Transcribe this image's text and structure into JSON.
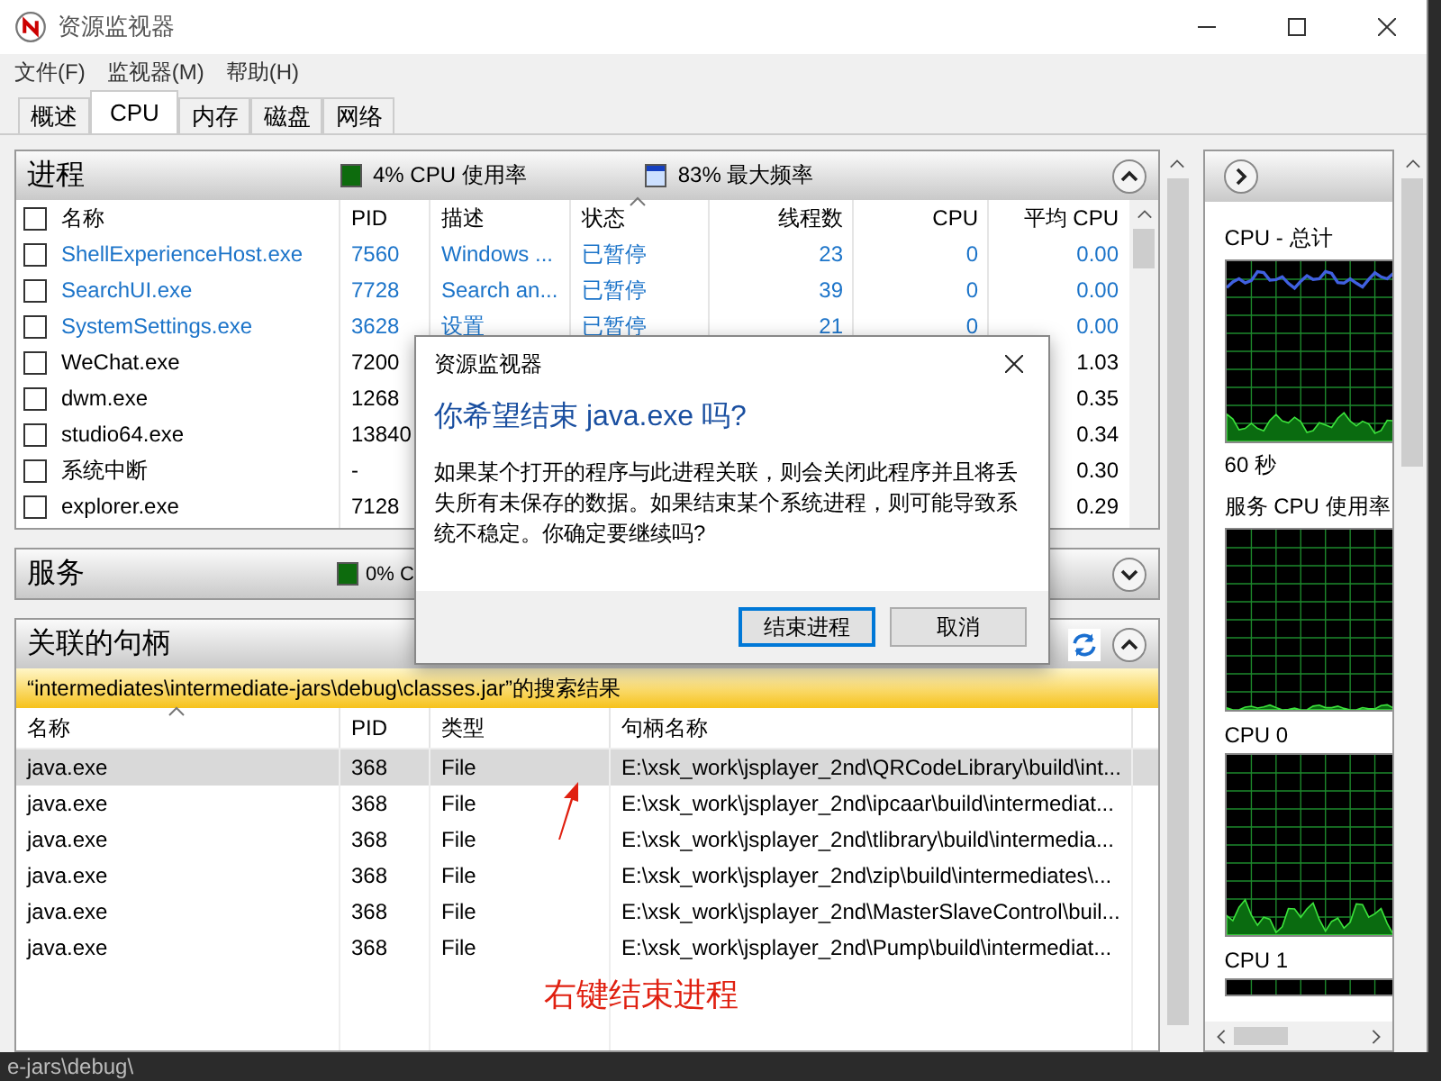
{
  "window": {
    "title": "资源监视器"
  },
  "menu": [
    "文件(F)",
    "监视器(M)",
    "帮助(H)"
  ],
  "tabs": [
    {
      "label": "概述",
      "selected": false
    },
    {
      "label": "CPU",
      "selected": true
    },
    {
      "label": "内存",
      "selected": false
    },
    {
      "label": "磁盘",
      "selected": false
    },
    {
      "label": "网络",
      "selected": false
    }
  ],
  "processes": {
    "title": "进程",
    "usage": "4% CPU 使用率",
    "frequency": "83% 最大频率",
    "expanded": true,
    "all_checked": false,
    "columns": [
      "名称",
      "PID",
      "描述",
      "状态",
      "线程数",
      "CPU",
      "平均 CPU"
    ],
    "rows": [
      {
        "name": "ShellExperienceHost.exe",
        "pid": "7560",
        "description": "Windows ...",
        "status": "已暂停",
        "threads": "23",
        "cpu": "0",
        "avg_cpu": "0.00",
        "suspended": true,
        "checked": false
      },
      {
        "name": "SearchUI.exe",
        "pid": "7728",
        "description": "Search an...",
        "status": "已暂停",
        "threads": "39",
        "cpu": "0",
        "avg_cpu": "0.00",
        "suspended": true,
        "checked": false
      },
      {
        "name": "SystemSettings.exe",
        "pid": "3628",
        "description": "设置",
        "status": "已暂停",
        "threads": "21",
        "cpu": "0",
        "avg_cpu": "0.00",
        "suspended": true,
        "checked": false
      },
      {
        "name": "WeChat.exe",
        "pid": "7200",
        "avg_cpu": "1.03",
        "suspended": false,
        "checked": false
      },
      {
        "name": "dwm.exe",
        "pid": "1268",
        "avg_cpu": "0.35",
        "suspended": false,
        "checked": false
      },
      {
        "name": "studio64.exe",
        "pid": "13840",
        "avg_cpu": "0.34",
        "suspended": false,
        "checked": false
      },
      {
        "name": "系统中断",
        "pid": "-",
        "avg_cpu": "0.30",
        "suspended": false,
        "checked": false
      },
      {
        "name": "explorer.exe",
        "pid": "7128",
        "avg_cpu": "0.29",
        "suspended": false,
        "checked": false
      }
    ]
  },
  "services": {
    "title": "服务",
    "usage": "0% C",
    "expanded": false
  },
  "handles": {
    "title": "关联的句柄",
    "expanded": true,
    "search_result": "“intermediates\\intermediate-jars\\debug\\classes.jar”的搜索结果",
    "columns": [
      "名称",
      "PID",
      "类型",
      "句柄名称"
    ],
    "rows": [
      {
        "name": "java.exe",
        "pid": "368",
        "type": "File",
        "handle": "E:\\xsk_work\\jsplayer_2nd\\QRCodeLibrary\\build\\int...",
        "selected": true
      },
      {
        "name": "java.exe",
        "pid": "368",
        "type": "File",
        "handle": "E:\\xsk_work\\jsplayer_2nd\\ipcaar\\build\\intermediat...",
        "selected": false
      },
      {
        "name": "java.exe",
        "pid": "368",
        "type": "File",
        "handle": "E:\\xsk_work\\jsplayer_2nd\\tlibrary\\build\\intermedia...",
        "selected": false
      },
      {
        "name": "java.exe",
        "pid": "368",
        "type": "File",
        "handle": "E:\\xsk_work\\jsplayer_2nd\\zip\\build\\intermediates\\...",
        "selected": false
      },
      {
        "name": "java.exe",
        "pid": "368",
        "type": "File",
        "handle": "E:\\xsk_work\\jsplayer_2nd\\MasterSlaveControl\\buil...",
        "selected": false
      },
      {
        "name": "java.exe",
        "pid": "368",
        "type": "File",
        "handle": "E:\\xsk_work\\jsplayer_2nd\\Pump\\build\\intermediat...",
        "selected": false
      }
    ]
  },
  "graphs": [
    {
      "title": "CPU - 总计",
      "caption": "60 秒"
    },
    {
      "title": "服务 CPU 使用率"
    },
    {
      "title": "CPU 0"
    },
    {
      "title": "CPU 1"
    }
  ],
  "dialog": {
    "title": "资源监视器",
    "heading": "你希望结束 java.exe 吗?",
    "message": "如果某个打开的程序与此进程关联，则会关闭此程序并且将丢失所有未保存的数据。如果结束某个系统进程，则可能导致系统不稳定。你确定要继续吗?",
    "buttons": [
      {
        "label": "结束进程",
        "default": true
      },
      {
        "label": "取消",
        "default": false
      }
    ]
  },
  "annotation": {
    "text": "右键结束进程"
  },
  "editor_strip": {
    "text": "e-jars\\debug\\"
  }
}
